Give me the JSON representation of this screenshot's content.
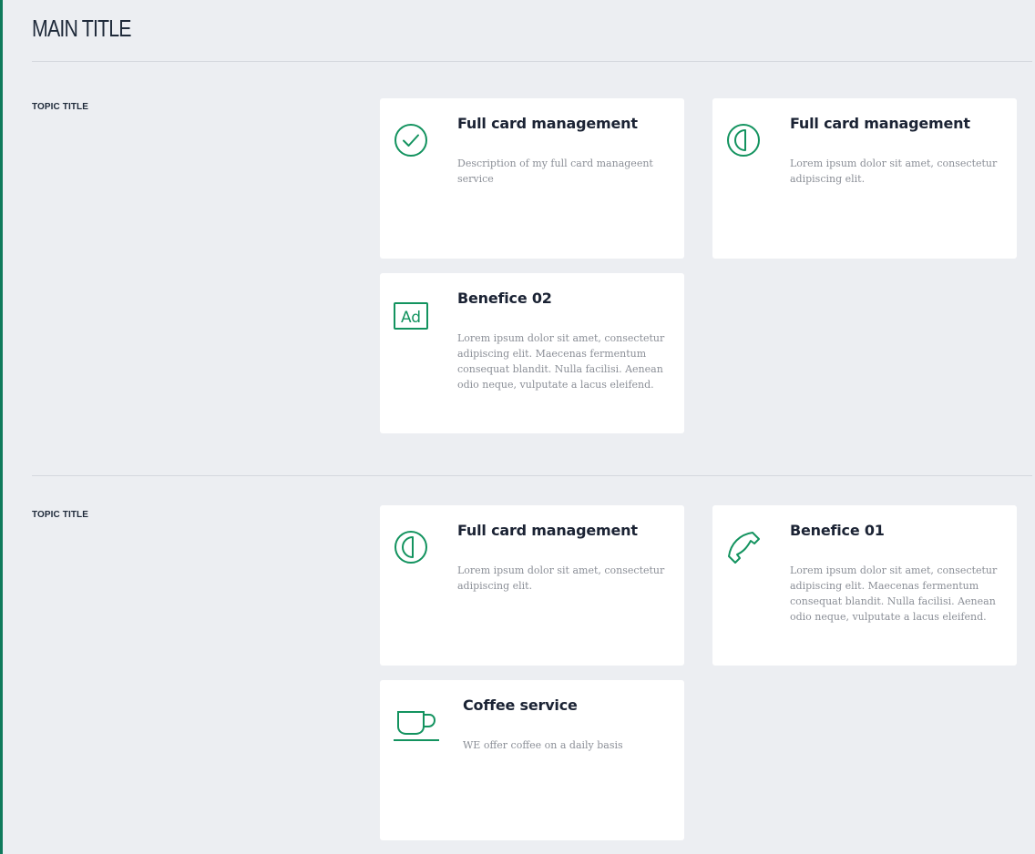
{
  "page": {
    "main_title": "MAIN TITLE"
  },
  "sections": [
    {
      "topic_title": "TOPIC TITLE",
      "cards": [
        {
          "icon": "check-circle-icon",
          "title": "Full card management",
          "description": "Description of my full card manageent service"
        },
        {
          "icon": "half-circle-icon",
          "title": "Full card management",
          "description": "Lorem ipsum dolor sit amet, consectetur adipiscing elit."
        },
        {
          "icon": "ad-icon",
          "icon_text": "Ad",
          "title": "Benefice 02",
          "description": "Lorem ipsum dolor sit amet, consectetur adipiscing elit. Maecenas fermentum consequat blandit. Nulla facilisi. Aenean odio neque, vulputate a lacus eleifend."
        }
      ]
    },
    {
      "topic_title": "TOPIC TITLE",
      "cards": [
        {
          "icon": "half-circle-icon",
          "title": "Full card management",
          "description": "Lorem ipsum dolor sit amet, consectetur adipiscing elit."
        },
        {
          "icon": "phone-icon",
          "title": "Benefice 01",
          "description": "Lorem ipsum dolor sit amet, consectetur adipiscing elit. Maecenas fermentum consequat blandit. Nulla facilisi. Aenean odio neque, vulputate a lacus eleifend."
        },
        {
          "icon": "coffee-cup-icon",
          "title": "Coffee service",
          "description": "WE offer coffee on a daily basis"
        }
      ]
    }
  ],
  "colors": {
    "accent": "#13935f",
    "background": "#eceef2",
    "card": "#ffffff",
    "rail": "#0f7a5c"
  }
}
